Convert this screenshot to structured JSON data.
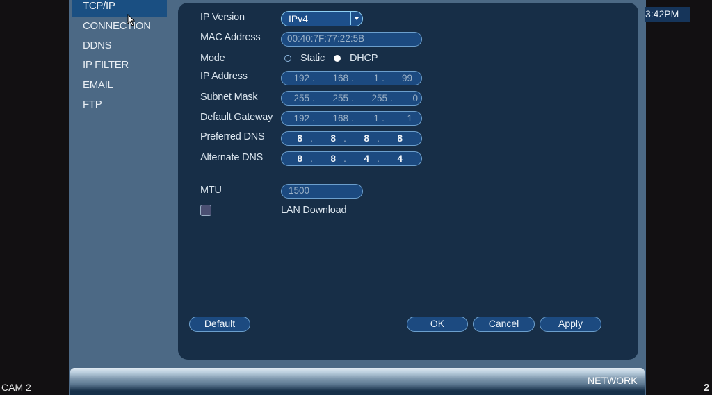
{
  "sidebar": {
    "items": [
      {
        "label": "TCP/IP",
        "selected": true
      },
      {
        "label": "CONNECTION",
        "selected": false
      },
      {
        "label": "DDNS",
        "selected": false
      },
      {
        "label": "IP FILTER",
        "selected": false
      },
      {
        "label": "EMAIL",
        "selected": false
      },
      {
        "label": "FTP",
        "selected": false
      }
    ]
  },
  "clock": "3:42PM",
  "form": {
    "ip_version": {
      "label": "IP Version",
      "value": "IPv4"
    },
    "mac": {
      "label": "MAC Address",
      "value": "00:40:7F:77:22:5B"
    },
    "mode": {
      "label": "Mode",
      "options": [
        "Static",
        "DHCP"
      ],
      "selected": "DHCP"
    },
    "ip_address": {
      "label": "IP Address",
      "octets": [
        "192",
        "168",
        "1",
        "99"
      ]
    },
    "subnet": {
      "label": "Subnet Mask",
      "octets": [
        "255",
        "255",
        "255",
        "0"
      ]
    },
    "gateway": {
      "label": "Default Gateway",
      "octets": [
        "192",
        "168",
        "1",
        "1"
      ]
    },
    "pdns": {
      "label": "Preferred DNS",
      "octets": [
        "8",
        "8",
        "8",
        "8"
      ]
    },
    "adns": {
      "label": "Alternate DNS",
      "octets": [
        "8",
        "8",
        "4",
        "4"
      ]
    },
    "mtu": {
      "label": "MTU",
      "value": "1500"
    },
    "lan_download": {
      "label": "LAN Download",
      "checked": false
    }
  },
  "buttons": {
    "default": "Default",
    "ok": "OK",
    "cancel": "Cancel",
    "apply": "Apply"
  },
  "bottom": {
    "section": "NETWORK",
    "cam": "CAM 2",
    "channel": "2"
  }
}
